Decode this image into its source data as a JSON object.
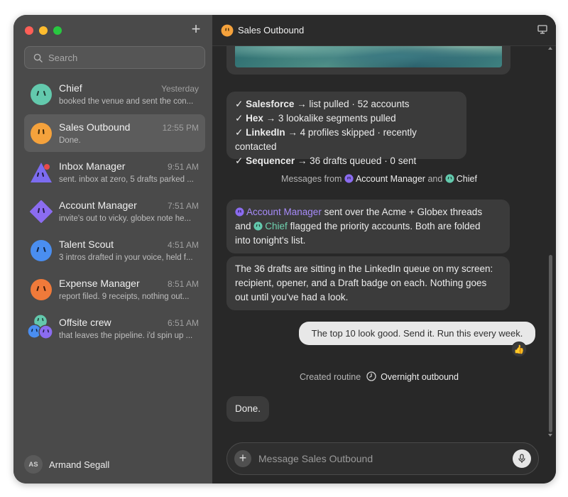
{
  "sidebar": {
    "search_placeholder": "Search",
    "conversations": [
      {
        "name": "Chief",
        "time": "Yesterday",
        "preview": "booked the venue and sent the con..."
      },
      {
        "name": "Sales Outbound",
        "time": "12:55 PM",
        "preview": "Done."
      },
      {
        "name": "Inbox Manager",
        "time": "9:51 AM",
        "preview": "sent. inbox at zero, 5 drafts parked ..."
      },
      {
        "name": "Account Manager",
        "time": "7:51 AM",
        "preview": "invite's out to vicky. globex note he..."
      },
      {
        "name": "Talent Scout",
        "time": "4:51 AM",
        "preview": "3 intros drafted in your voice, held f..."
      },
      {
        "name": "Expense Manager",
        "time": "8:51 AM",
        "preview": "report filed. 9 receipts, nothing out..."
      },
      {
        "name": "Offsite crew",
        "time": "6:51 AM",
        "preview": "that leaves the pipeline. i'd spin up ..."
      }
    ],
    "user": {
      "initials": "AS",
      "name": "Armand Segall"
    }
  },
  "header": {
    "title": "Sales Outbound"
  },
  "messages": {
    "checks": [
      {
        "mark": "✓",
        "bold": "Salesforce",
        "rest": " → list pulled · 52 accounts"
      },
      {
        "mark": "✓",
        "bold": "Hex",
        "rest": " → 3 lookalike segments pulled"
      },
      {
        "mark": "✓",
        "bold": "LinkedIn",
        "rest": " → 4 profiles skipped · recently contacted"
      },
      {
        "mark": "✓",
        "bold": "Sequencer",
        "rest": " → 36 drafts queued · 0 sent"
      }
    ],
    "from_line": {
      "prefix": "Messages from",
      "agent1": "Account Manager",
      "conj": "and",
      "agent2": "Chief"
    },
    "folded": {
      "agent1": "Account Manager",
      "text1": " sent over the Acme + Globex threads",
      "and": "and",
      "agent2": "Chief",
      "text2": " flagged the priority accounts. Both are folded",
      "text3": "into tonight's list."
    },
    "drafts": {
      "line1": "The 36 drafts are sitting in the LinkedIn queue on my screen:",
      "line2": "recipient, opener, and a Draft badge on each. Nothing goes",
      "line3": "out until you've had a look."
    },
    "user_msg": "The top 10 look good. Send it. Run this every week.",
    "reaction": "👍",
    "routine": {
      "prefix": "Created routine",
      "name": "Overnight outbound"
    },
    "done": "Done."
  },
  "composer": {
    "placeholder": "Message Sales Outbound"
  },
  "colors": {
    "accent_purple": "#a78bfa",
    "accent_teal": "#6fd3b0",
    "sales_orange": "#f5a23c"
  }
}
